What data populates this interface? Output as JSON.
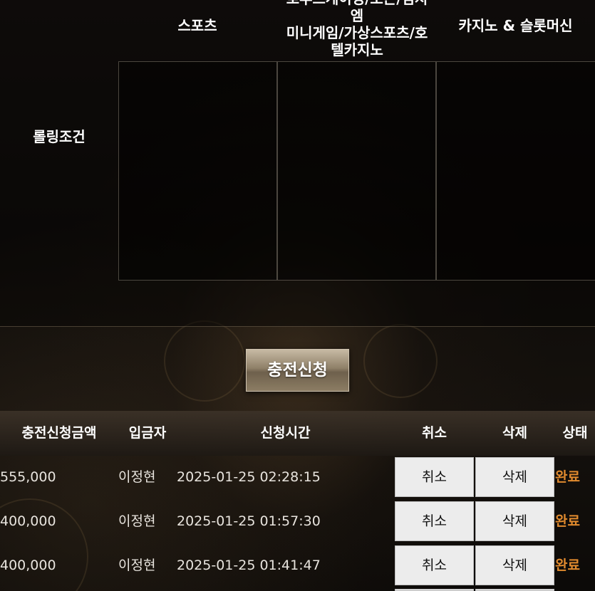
{
  "rolling": {
    "label": "롤링조건",
    "columns": [
      "스포츠",
      "로투스게이밍/보는/검지 엠\n미니게임/가상스포츠/호 텔카지노",
      "카지노 & 슬롯머신"
    ]
  },
  "charge_button": "충전신청",
  "history": {
    "headers": [
      "충전신청금액",
      "입금자",
      "신청시간",
      "취소",
      "삭제",
      "상태"
    ],
    "rows": [
      {
        "amount": "555,000",
        "depositor": "이정현",
        "time": "2025-01-25 02:28:15",
        "cancel": "취소",
        "delete": "삭제",
        "status": "완료"
      },
      {
        "amount": "400,000",
        "depositor": "이정현",
        "time": "2025-01-25 01:57:30",
        "cancel": "취소",
        "delete": "삭제",
        "status": "완료"
      },
      {
        "amount": "400,000",
        "depositor": "이정현",
        "time": "2025-01-25 01:41:47",
        "cancel": "취소",
        "delete": "삭제",
        "status": "완료"
      }
    ]
  },
  "colors": {
    "status_complete": "#e08a2e",
    "button_bg": "#ececec"
  }
}
